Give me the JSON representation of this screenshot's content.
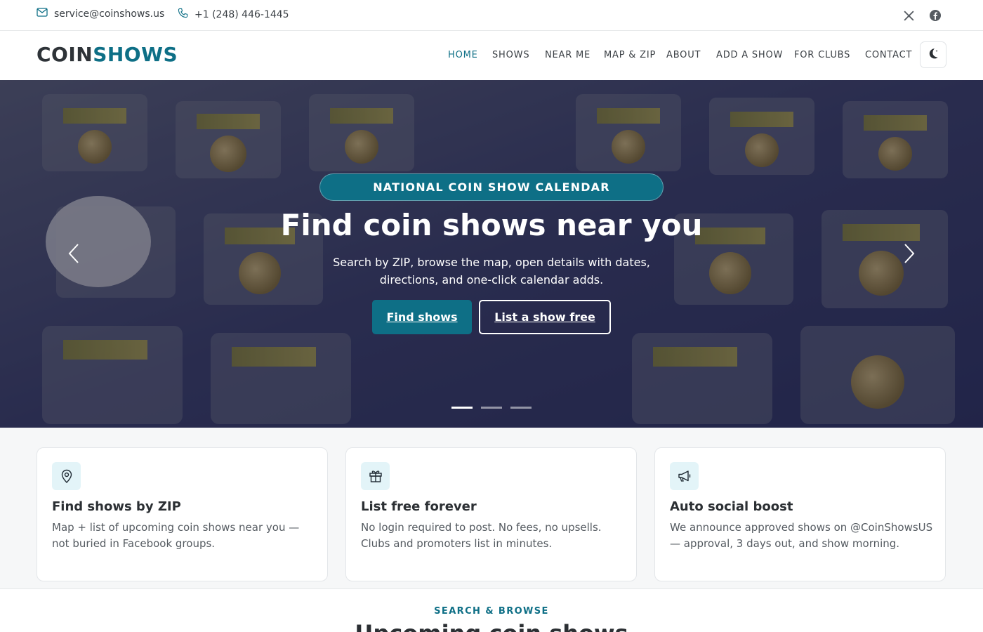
{
  "topbar": {
    "email": "service@coinshows.us",
    "phone": "+1 (248) 446-1445",
    "email_icon": "envelope-icon",
    "phone_icon": "phone-icon",
    "social": [
      "x-icon",
      "facebook-icon"
    ]
  },
  "brand": {
    "part1": "COIN",
    "part2": "SHOWS"
  },
  "nav": {
    "items": [
      {
        "label": "HOME",
        "active": true
      },
      {
        "label": "SHOWS"
      },
      {
        "label": "NEAR ME"
      },
      {
        "label": "MAP & ZIP"
      },
      {
        "label": "ABOUT"
      },
      {
        "label": "ADD A SHOW"
      },
      {
        "label": "FOR CLUBS"
      },
      {
        "label": "CONTACT"
      }
    ],
    "theme_toggle_icon": "moon-icon"
  },
  "hero": {
    "badge": "NATIONAL COIN SHOW CALENDAR",
    "title": "Find coin shows near you",
    "subtitle": "Search by ZIP, browse the map, open details with dates, directions, and one-click calendar adds.",
    "primary_button": "Find shows",
    "secondary_button": "List a show free",
    "slide_count": 3,
    "active_slide": 1
  },
  "features": [
    {
      "icon": "map-pin-icon",
      "title": "Find shows by ZIP",
      "text": "Map + list of upcoming coin shows near you — not buried in Facebook groups."
    },
    {
      "icon": "gift-icon",
      "title": "List free forever",
      "text": "No login required to post. No fees, no upsells. Clubs and promoters list in minutes."
    },
    {
      "icon": "megaphone-icon",
      "title": "Auto social boost",
      "text": "We announce approved shows on @CoinShowsUS — approval, 3 days out, and show morning."
    }
  ],
  "section": {
    "eyebrow": "SEARCH & BROWSE",
    "title": "Upcoming coin shows"
  },
  "colors": {
    "accent": "#0e6f86",
    "accent_light": "#e3f4f8"
  }
}
